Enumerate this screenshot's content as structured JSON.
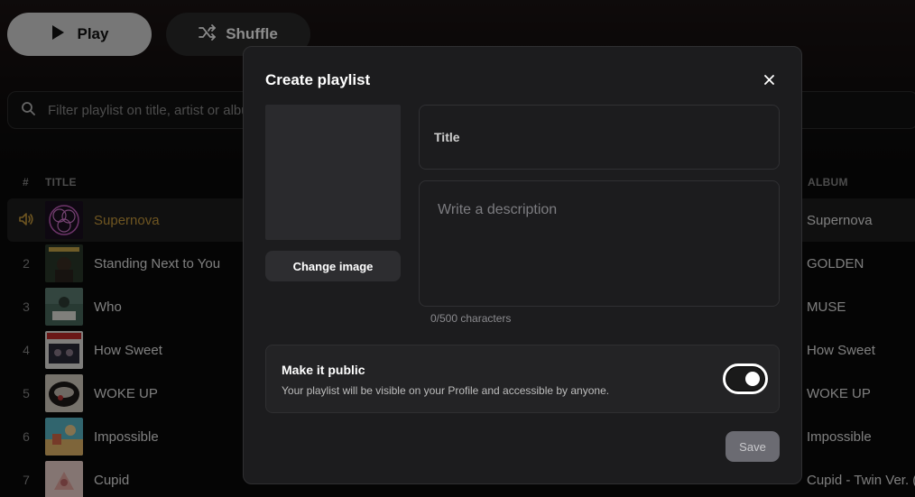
{
  "player": {
    "play_label": "Play",
    "shuffle_label": "Shuffle"
  },
  "filter": {
    "placeholder": "Filter playlist on title, artist or album"
  },
  "columns": {
    "number": "#",
    "title": "TITLE",
    "album": "ALBUM"
  },
  "tracks": [
    {
      "number": "",
      "title": "Supernova",
      "album": "Supernova",
      "playing": true
    },
    {
      "number": "2",
      "title": "Standing Next to You",
      "album": "GOLDEN"
    },
    {
      "number": "3",
      "title": "Who",
      "album": "MUSE"
    },
    {
      "number": "4",
      "title": "How Sweet",
      "album": "How Sweet"
    },
    {
      "number": "5",
      "title": "WOKE UP",
      "album": "WOKE UP"
    },
    {
      "number": "6",
      "title": "Impossible",
      "album": "Impossible"
    },
    {
      "number": "7",
      "title": "Cupid",
      "album": "Cupid - Twin Ver. (S"
    }
  ],
  "colors": {
    "accent": "#c89b3c",
    "modal_bg": "#1c1c1e",
    "save_disabled": "#6b6b72"
  },
  "modal": {
    "title": "Create playlist",
    "change_image_label": "Change image",
    "title_field_label": "Title",
    "description_placeholder": "Write a description",
    "char_count": "0/500 characters",
    "public_title": "Make it public",
    "public_desc": "Your playlist will be visible on your Profile and accessible by anyone.",
    "public_enabled": true,
    "save_label": "Save"
  }
}
